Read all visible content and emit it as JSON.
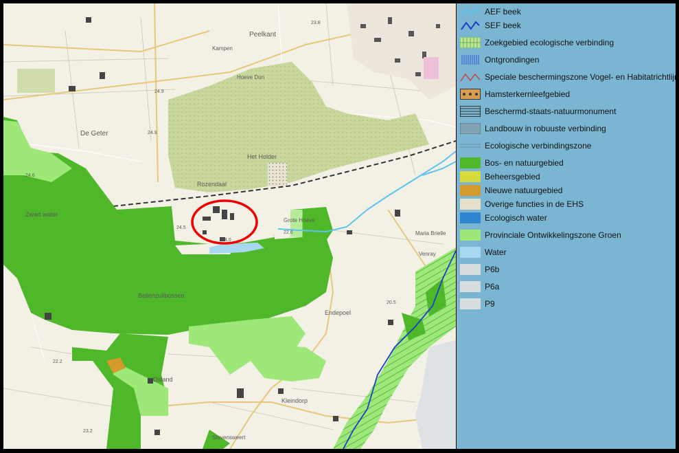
{
  "map": {
    "place_labels": [
      {
        "id": "peelkant",
        "text": "Peelkant"
      },
      {
        "id": "de-geter",
        "text": "De Geter"
      },
      {
        "id": "bosje",
        "text": "Hoeve Dun"
      },
      {
        "id": "het-holder",
        "text": "Het Holder"
      },
      {
        "id": "rozendaal",
        "text": "Rozendaal"
      },
      {
        "id": "zwart-water",
        "text": "Zwart water"
      },
      {
        "id": "grote-hoeve",
        "text": "Grote Hoeve"
      },
      {
        "id": "elsendonk",
        "text": "Endepoel"
      },
      {
        "id": "daland",
        "text": "Daland"
      },
      {
        "id": "kleindorp",
        "text": "Kleindorp"
      },
      {
        "id": "venray",
        "text": "Venray"
      },
      {
        "id": "maria-brielle",
        "text": "Maria Brielle"
      },
      {
        "id": "stevensweert",
        "text": "Stevensweert"
      },
      {
        "id": "kampen",
        "text": "Kampen"
      },
      {
        "id": "landgoed",
        "text": "Bellenzuilbossen"
      }
    ],
    "elevation_labels": [
      "24.9",
      "24.9",
      "24.6",
      "24.5",
      "24.0",
      "22.6",
      "22.2",
      "23.2",
      "20.5",
      "23.8"
    ],
    "highlight": "red-circle"
  },
  "legend": {
    "items": [
      {
        "id": "aef-beek",
        "label": "AEF beek",
        "kind": "line",
        "color": "#5bc4ee"
      },
      {
        "id": "sef-beek",
        "label": "SEF beek",
        "kind": "line",
        "color": "#1a40c8"
      },
      {
        "id": "zoekgebied",
        "label": "Zoekgebied ecologische verbinding",
        "kind": "grid",
        "color": "#6ab04c"
      },
      {
        "id": "ontgrondingen",
        "label": "Ontgrondingen",
        "kind": "vlines",
        "color": "#2f5bd8"
      },
      {
        "id": "speciale",
        "label": "Speciale beschermingszone Vogel- en Habitatrichtlijn",
        "kind": "zigzag",
        "color": "#c44"
      },
      {
        "id": "hamster",
        "label": "Hamsterkernleefgebied",
        "kind": "dots",
        "color": "#d89c52"
      },
      {
        "id": "beschermd",
        "label": "Beschermd-staats-natuurmonument",
        "kind": "hlines",
        "color": "#333"
      },
      {
        "id": "landbouw",
        "label": "Landbouw in robuuste verbinding",
        "kind": "vlines-grey",
        "color": "#888"
      },
      {
        "id": "ecoverbind",
        "label": "Ecologische verbindingszone",
        "kind": "thinlines",
        "color": "#6a8ea6"
      },
      {
        "id": "bos",
        "label": "Bos- en natuurgebied",
        "kind": "fill",
        "color": "#4fb82a"
      },
      {
        "id": "beheer",
        "label": "Beheersgebied",
        "kind": "fill",
        "color": "#d6da3a"
      },
      {
        "id": "nieuwe",
        "label": "Nieuwe natuurgebied",
        "kind": "fill",
        "color": "#d49a2c"
      },
      {
        "id": "overige",
        "label": "Overige functies in de EHS",
        "kind": "fill",
        "color": "#e4e0cc"
      },
      {
        "id": "ecowater",
        "label": "Ecologisch water",
        "kind": "fill",
        "color": "#2f86d0"
      },
      {
        "id": "pog",
        "label": "Provinciale Ontwikkelingszone Groen",
        "kind": "fill",
        "color": "#9de878"
      },
      {
        "id": "water",
        "label": "Water",
        "kind": "fill",
        "color": "#a8d8f0"
      },
      {
        "id": "p6b",
        "label": "P6b",
        "kind": "fill",
        "color": "#d8dde0"
      },
      {
        "id": "p6a",
        "label": "P6a",
        "kind": "fill",
        "color": "#d8dde0"
      },
      {
        "id": "p9",
        "label": "P9",
        "kind": "fill",
        "color": "#d8dde0"
      }
    ]
  }
}
